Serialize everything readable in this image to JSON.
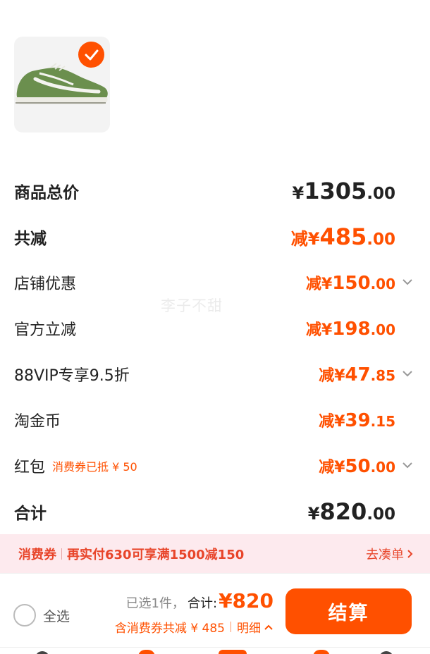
{
  "product": {
    "image_icon": "sneaker-image",
    "selected": true
  },
  "price_rows": [
    {
      "label": "商品总价",
      "prefix": "¥",
      "int": "1305",
      "dec": ".00",
      "style": "total"
    },
    {
      "label": "共减",
      "prefix": "减¥",
      "int": "485",
      "dec": ".00",
      "style": "discount-total"
    },
    {
      "label": "店铺优惠",
      "prefix": "减¥",
      "int": "150",
      "dec": ".00",
      "expandable": true
    },
    {
      "label": "官方立减",
      "prefix": "减¥",
      "int": "198",
      "dec": ".00",
      "expandable": false
    },
    {
      "label": "88VIP专享9.5折",
      "prefix": "减¥",
      "int": "47",
      "dec": ".85",
      "expandable": true
    },
    {
      "label": "淘金币",
      "prefix": "减¥",
      "int": "39",
      "dec": ".15",
      "expandable": false
    },
    {
      "label": "红包",
      "note": "消费券已抵 ¥ 50",
      "prefix": "减¥",
      "int": "50",
      "dec": ".00",
      "expandable": true
    },
    {
      "label": "合计",
      "prefix": "¥",
      "int": "820",
      "dec": ".00",
      "style": "total"
    }
  ],
  "watermark": "李子不甜",
  "coupon_banner": {
    "tag": "消费券",
    "message": "再实付630可享满1500减150",
    "action": "去凑单"
  },
  "bottom_bar": {
    "select_all": "全选",
    "selected_count": "已选1件，",
    "total_label": "合计:",
    "total_amount": "¥820",
    "coupon_note": "含消费券共减 ¥ 485",
    "detail_label": "明细",
    "checkout_label": "结算"
  },
  "colors": {
    "accent": "#ff5000",
    "banner_bg": "#fdeaee",
    "banner_text": "#e8452a"
  }
}
